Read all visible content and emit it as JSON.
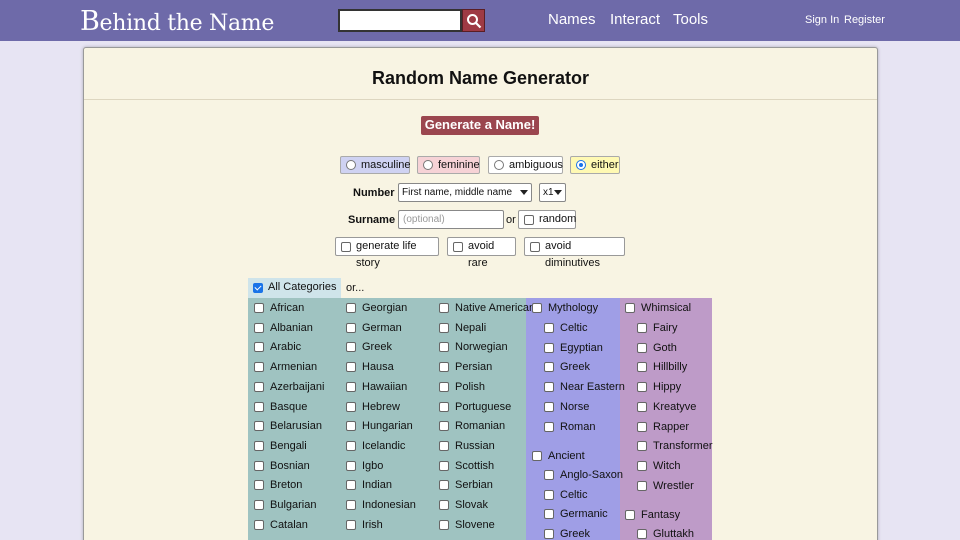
{
  "header": {
    "logo_first": "B",
    "logo_rest": "ehind the Name",
    "nav": [
      "Names",
      "Interact",
      "Tools"
    ],
    "sign_in": "Sign In",
    "register": "Register"
  },
  "page": {
    "title": "Random Name Generator",
    "generate_label": "Generate a Name!"
  },
  "gender": {
    "options": [
      "masculine",
      "feminine",
      "ambiguous",
      "either"
    ],
    "selected": "either"
  },
  "number": {
    "label": "Number",
    "value": "First name, middle name",
    "count": "x1"
  },
  "surname": {
    "label": "Surname",
    "placeholder": "(optional)",
    "or": "or",
    "random_label": "random"
  },
  "options": [
    "generate life story",
    "avoid rare",
    "avoid diminutives"
  ],
  "categories": {
    "all_label": "All Categories",
    "or_label": "or...",
    "col1": [
      "African",
      "Albanian",
      "Arabic",
      "Armenian",
      "Azerbaijani",
      "Basque",
      "Belarusian",
      "Bengali",
      "Bosnian",
      "Breton",
      "Bulgarian",
      "Catalan"
    ],
    "col2": [
      "Georgian",
      "German",
      "Greek",
      "Hausa",
      "Hawaiian",
      "Hebrew",
      "Hungarian",
      "Icelandic",
      "Igbo",
      "Indian",
      "Indonesian",
      "Irish"
    ],
    "col3": [
      "Native American",
      "Nepali",
      "Norwegian",
      "Persian",
      "Polish",
      "Portuguese",
      "Romanian",
      "Russian",
      "Scottish",
      "Serbian",
      "Slovak",
      "Slovene"
    ],
    "mythology": {
      "label": "Mythology",
      "items": [
        "Celtic",
        "Egyptian",
        "Greek",
        "Near Eastern",
        "Norse",
        "Roman"
      ]
    },
    "ancient": {
      "label": "Ancient",
      "items": [
        "Anglo-Saxon",
        "Celtic",
        "Germanic",
        "Greek"
      ]
    },
    "whimsical": {
      "label": "Whimsical",
      "items": [
        "Fairy",
        "Goth",
        "Hillbilly",
        "Hippy",
        "Kreatyve",
        "Rapper",
        "Transformer",
        "Witch",
        "Wrestler"
      ]
    },
    "fantasy": {
      "label": "Fantasy",
      "items": [
        "Gluttakh"
      ]
    }
  },
  "colors": {
    "topbar": "#6e6aa9",
    "generate": "#9b464f",
    "teal": "#9fc3c1",
    "blue": "#9f9ee6",
    "purple": "#be9bc8"
  },
  "icons": [
    "search-icon"
  ]
}
